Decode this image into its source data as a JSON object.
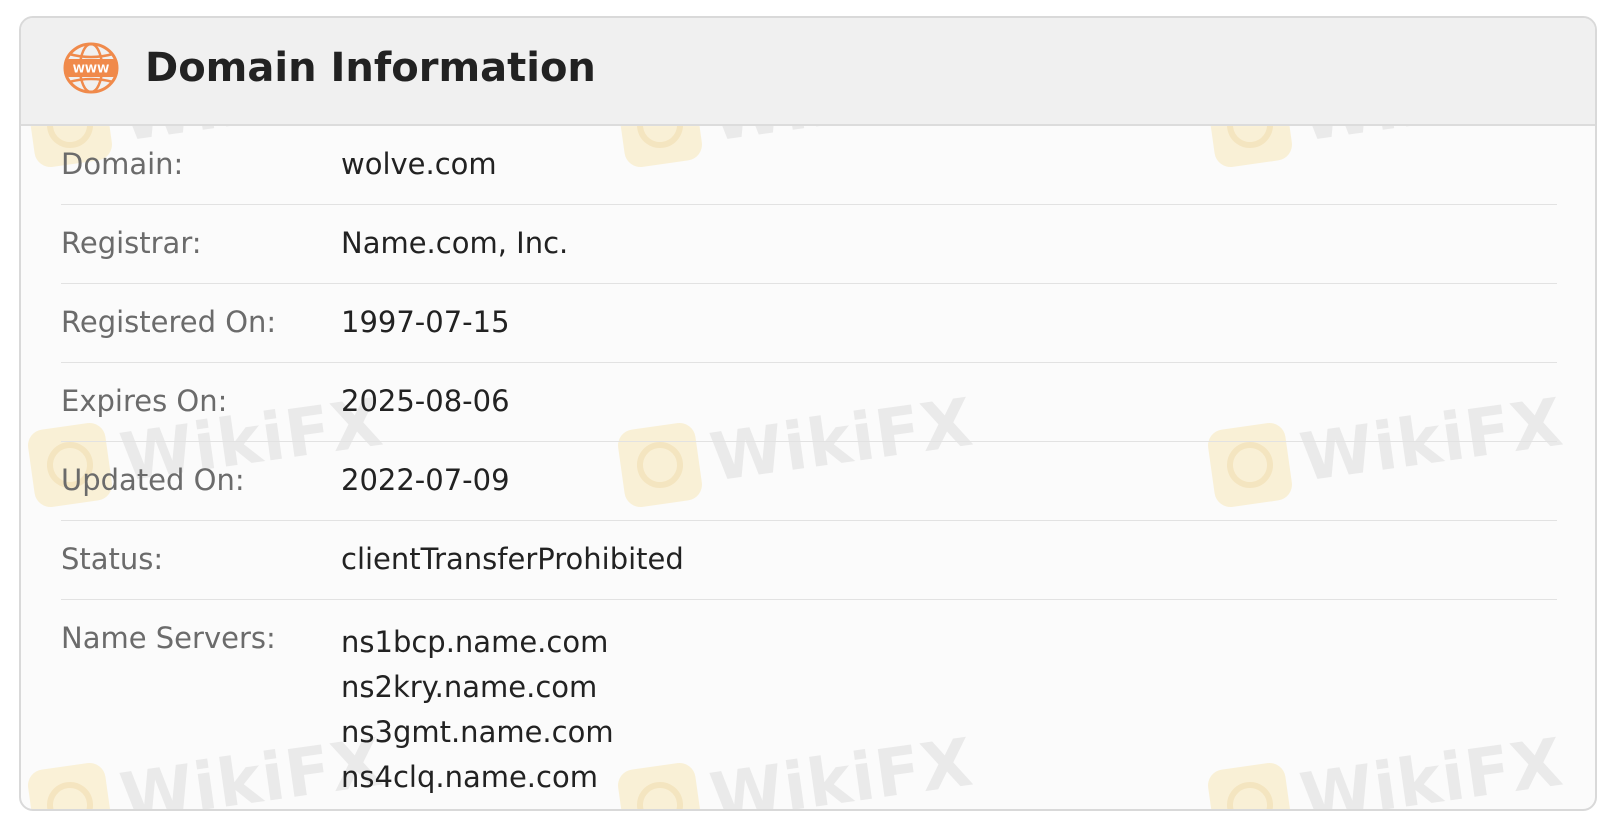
{
  "header": {
    "title": "Domain Information",
    "icon": "www-globe-icon",
    "icon_text": "WWW",
    "accent_color": "#f08a4b"
  },
  "rows": [
    {
      "label": "Domain:",
      "value": "wolve.com"
    },
    {
      "label": "Registrar:",
      "value": "Name.com, Inc."
    },
    {
      "label": "Registered On:",
      "value": "1997-07-15"
    },
    {
      "label": "Expires On:",
      "value": "2025-08-06"
    },
    {
      "label": "Updated On:",
      "value": "2022-07-09"
    },
    {
      "label": "Status:",
      "value": "clientTransferProhibited"
    }
  ],
  "name_servers": {
    "label": "Name Servers:",
    "values": [
      "ns1bcp.name.com",
      "ns2kry.name.com",
      "ns3gmt.name.com",
      "ns4clq.name.com"
    ]
  },
  "watermark": {
    "text": "WikiFX"
  }
}
